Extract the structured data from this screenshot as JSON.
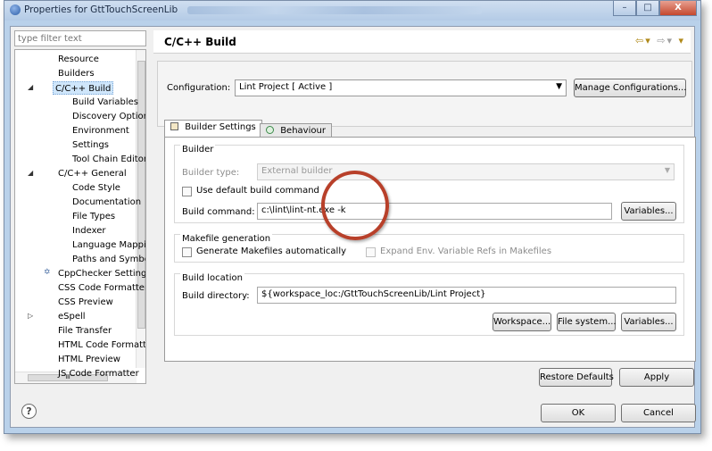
{
  "window": {
    "title": "Properties for GttTouchScreenLib",
    "close_label": "X"
  },
  "left": {
    "filter_placeholder": "type filter text",
    "tree": [
      {
        "label": "Resource",
        "indent": 0
      },
      {
        "label": "Builders",
        "indent": 0
      },
      {
        "label": "C/C++ Build",
        "indent": 0,
        "expanded": true,
        "selected": true
      },
      {
        "label": "Build Variables",
        "indent": 1
      },
      {
        "label": "Discovery Options",
        "indent": 1
      },
      {
        "label": "Environment",
        "indent": 1
      },
      {
        "label": "Settings",
        "indent": 1
      },
      {
        "label": "Tool Chain Editor",
        "indent": 1
      },
      {
        "label": "C/C++ General",
        "indent": 0,
        "expanded": true
      },
      {
        "label": "Code Style",
        "indent": 1
      },
      {
        "label": "Documentation",
        "indent": 1
      },
      {
        "label": "File Types",
        "indent": 1
      },
      {
        "label": "Indexer",
        "indent": 1
      },
      {
        "label": "Language Mappings",
        "indent": 1
      },
      {
        "label": "Paths and Symbols",
        "indent": 1
      },
      {
        "label": "CppChecker Settings",
        "indent": 0
      },
      {
        "label": "CSS Code Formatter",
        "indent": 0
      },
      {
        "label": "CSS Preview",
        "indent": 0
      },
      {
        "label": "eSpell",
        "indent": 0,
        "collapsed": true
      },
      {
        "label": "File Transfer",
        "indent": 0
      },
      {
        "label": "HTML Code Formatter",
        "indent": 0
      },
      {
        "label": "HTML Preview",
        "indent": 0
      },
      {
        "label": "JS Code Formatter",
        "indent": 0
      }
    ],
    "hscroll_label": "III"
  },
  "header": {
    "title": "C/C++ Build"
  },
  "config": {
    "label": "Configuration:",
    "value": "Lint Project  [ Active ]",
    "manage_button": "Manage Configurations..."
  },
  "tabs": [
    {
      "label": "Builder Settings"
    },
    {
      "label": "Behaviour"
    }
  ],
  "builder": {
    "group_title": "Builder",
    "type_label": "Builder type:",
    "type_value": "External builder",
    "use_default_label": "Use default build command",
    "command_label": "Build command:",
    "command_value": "c:\\lint\\lint-nt.exe -k",
    "variables_button": "Variables..."
  },
  "makefile": {
    "group_title": "Makefile generation",
    "generate_label": "Generate Makefiles automatically",
    "expand_label": "Expand Env. Variable Refs in Makefiles"
  },
  "location": {
    "group_title": "Build location",
    "dir_label": "Build directory:",
    "dir_value": "${workspace_loc:/GttTouchScreenLib/Lint Project}",
    "workspace_button": "Workspace...",
    "filesystem_button": "File system...",
    "variables_button": "Variables..."
  },
  "footer": {
    "restore_button": "Restore Defaults",
    "apply_button": "Apply",
    "ok_button": "OK",
    "cancel_button": "Cancel",
    "help_symbol": "?"
  }
}
